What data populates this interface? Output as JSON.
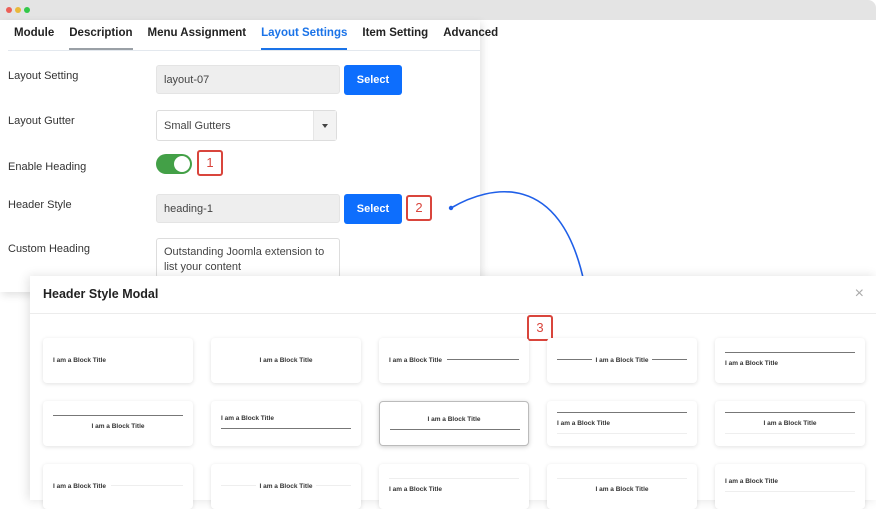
{
  "window": {
    "controls": [
      "close",
      "minimize",
      "maximize"
    ]
  },
  "tabs": [
    {
      "label": "Module",
      "active": false
    },
    {
      "label": "Description",
      "active": false
    },
    {
      "label": "Menu Assignment",
      "active": false
    },
    {
      "label": "Layout Settings",
      "active": true
    },
    {
      "label": "Item Setting",
      "active": false
    },
    {
      "label": "Advanced",
      "active": false
    }
  ],
  "form": {
    "layout_setting": {
      "label": "Layout Setting",
      "value": "layout-07",
      "button": "Select"
    },
    "layout_gutter": {
      "label": "Layout Gutter",
      "value": "Small Gutters"
    },
    "enable_heading": {
      "label": "Enable Heading",
      "enabled": true
    },
    "header_style": {
      "label": "Header Style",
      "value": "heading-1",
      "button": "Select"
    },
    "custom_heading": {
      "label": "Custom Heading",
      "value": "Outstanding Joomla extension to list your content"
    }
  },
  "annotations": {
    "step1": "1",
    "step2": "2",
    "step3": "3"
  },
  "colors": {
    "accent": "#1a73e8",
    "button": "#0d6efd",
    "toggle_on": "#43a047",
    "annotation": "#d9453c"
  },
  "modal": {
    "title": "Header Style Modal",
    "close_icon": "×",
    "card_title": "I am a Block Title",
    "styles": [
      {
        "name": "heading-1"
      },
      {
        "name": "heading-2"
      },
      {
        "name": "heading-3"
      },
      {
        "name": "heading-4"
      },
      {
        "name": "heading-5"
      },
      {
        "name": "heading-6"
      },
      {
        "name": "heading-7"
      },
      {
        "name": "heading-8",
        "selected": true
      },
      {
        "name": "heading-9"
      },
      {
        "name": "heading-10"
      },
      {
        "name": "heading-11"
      },
      {
        "name": "heading-12"
      },
      {
        "name": "heading-13"
      },
      {
        "name": "heading-14"
      },
      {
        "name": "heading-15"
      }
    ]
  }
}
